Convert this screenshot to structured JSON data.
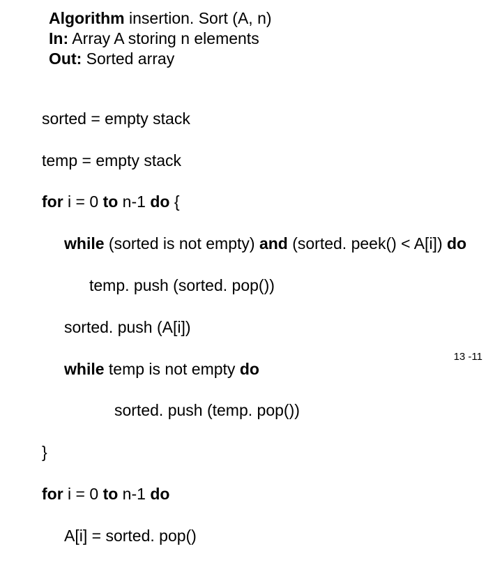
{
  "header": {
    "algo_kw": "Algorithm",
    "algo_name": " insertion. Sort (A, n)",
    "in_kw": "In:",
    "in_txt": " Array A storing n elements",
    "out_kw": "Out:",
    "out_txt": " Sorted array"
  },
  "body": {
    "l1": "sorted = empty stack",
    "l2": "temp = empty stack",
    "l3a": "for",
    "l3b": " i = 0 ",
    "l3c": "to",
    "l3d": " n-1 ",
    "l3e": "do",
    "l3f": " {",
    "l4a": "while",
    "l4b": " (sorted is not empty) ",
    "l4c": "and",
    "l4d": " (sorted. peek() < A[i]) ",
    "l4e": "do",
    "l5": "temp. push (sorted. pop())",
    "l6": "sorted. push (A[i])",
    "l7a": "while",
    "l7b": " temp is not empty ",
    "l7c": "do",
    "l8": "sorted. push (temp. pop())",
    "l9": "}",
    "l10a": "for",
    "l10b": " i = 0 ",
    "l10c": "to",
    "l10d": " n-1 ",
    "l10e": "do",
    "l11": "A[i] = sorted. pop()"
  },
  "pagenum": "13 -11"
}
